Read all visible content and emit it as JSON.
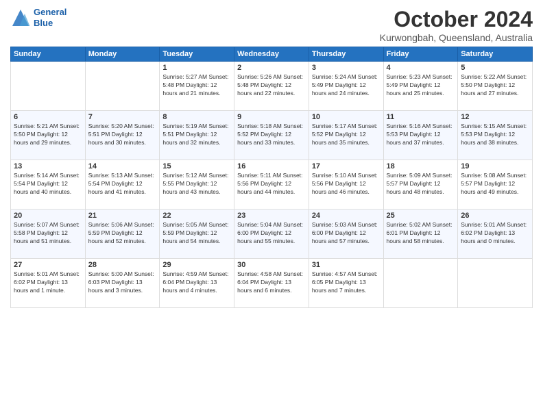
{
  "header": {
    "logo_line1": "General",
    "logo_line2": "Blue",
    "month": "October 2024",
    "location": "Kurwongbah, Queensland, Australia"
  },
  "days_of_week": [
    "Sunday",
    "Monday",
    "Tuesday",
    "Wednesday",
    "Thursday",
    "Friday",
    "Saturday"
  ],
  "weeks": [
    [
      {
        "day": "",
        "info": ""
      },
      {
        "day": "",
        "info": ""
      },
      {
        "day": "1",
        "info": "Sunrise: 5:27 AM\nSunset: 5:48 PM\nDaylight: 12 hours\nand 21 minutes."
      },
      {
        "day": "2",
        "info": "Sunrise: 5:26 AM\nSunset: 5:48 PM\nDaylight: 12 hours\nand 22 minutes."
      },
      {
        "day": "3",
        "info": "Sunrise: 5:24 AM\nSunset: 5:49 PM\nDaylight: 12 hours\nand 24 minutes."
      },
      {
        "day": "4",
        "info": "Sunrise: 5:23 AM\nSunset: 5:49 PM\nDaylight: 12 hours\nand 25 minutes."
      },
      {
        "day": "5",
        "info": "Sunrise: 5:22 AM\nSunset: 5:50 PM\nDaylight: 12 hours\nand 27 minutes."
      }
    ],
    [
      {
        "day": "6",
        "info": "Sunrise: 5:21 AM\nSunset: 5:50 PM\nDaylight: 12 hours\nand 29 minutes."
      },
      {
        "day": "7",
        "info": "Sunrise: 5:20 AM\nSunset: 5:51 PM\nDaylight: 12 hours\nand 30 minutes."
      },
      {
        "day": "8",
        "info": "Sunrise: 5:19 AM\nSunset: 5:51 PM\nDaylight: 12 hours\nand 32 minutes."
      },
      {
        "day": "9",
        "info": "Sunrise: 5:18 AM\nSunset: 5:52 PM\nDaylight: 12 hours\nand 33 minutes."
      },
      {
        "day": "10",
        "info": "Sunrise: 5:17 AM\nSunset: 5:52 PM\nDaylight: 12 hours\nand 35 minutes."
      },
      {
        "day": "11",
        "info": "Sunrise: 5:16 AM\nSunset: 5:53 PM\nDaylight: 12 hours\nand 37 minutes."
      },
      {
        "day": "12",
        "info": "Sunrise: 5:15 AM\nSunset: 5:53 PM\nDaylight: 12 hours\nand 38 minutes."
      }
    ],
    [
      {
        "day": "13",
        "info": "Sunrise: 5:14 AM\nSunset: 5:54 PM\nDaylight: 12 hours\nand 40 minutes."
      },
      {
        "day": "14",
        "info": "Sunrise: 5:13 AM\nSunset: 5:54 PM\nDaylight: 12 hours\nand 41 minutes."
      },
      {
        "day": "15",
        "info": "Sunrise: 5:12 AM\nSunset: 5:55 PM\nDaylight: 12 hours\nand 43 minutes."
      },
      {
        "day": "16",
        "info": "Sunrise: 5:11 AM\nSunset: 5:56 PM\nDaylight: 12 hours\nand 44 minutes."
      },
      {
        "day": "17",
        "info": "Sunrise: 5:10 AM\nSunset: 5:56 PM\nDaylight: 12 hours\nand 46 minutes."
      },
      {
        "day": "18",
        "info": "Sunrise: 5:09 AM\nSunset: 5:57 PM\nDaylight: 12 hours\nand 48 minutes."
      },
      {
        "day": "19",
        "info": "Sunrise: 5:08 AM\nSunset: 5:57 PM\nDaylight: 12 hours\nand 49 minutes."
      }
    ],
    [
      {
        "day": "20",
        "info": "Sunrise: 5:07 AM\nSunset: 5:58 PM\nDaylight: 12 hours\nand 51 minutes."
      },
      {
        "day": "21",
        "info": "Sunrise: 5:06 AM\nSunset: 5:59 PM\nDaylight: 12 hours\nand 52 minutes."
      },
      {
        "day": "22",
        "info": "Sunrise: 5:05 AM\nSunset: 5:59 PM\nDaylight: 12 hours\nand 54 minutes."
      },
      {
        "day": "23",
        "info": "Sunrise: 5:04 AM\nSunset: 6:00 PM\nDaylight: 12 hours\nand 55 minutes."
      },
      {
        "day": "24",
        "info": "Sunrise: 5:03 AM\nSunset: 6:00 PM\nDaylight: 12 hours\nand 57 minutes."
      },
      {
        "day": "25",
        "info": "Sunrise: 5:02 AM\nSunset: 6:01 PM\nDaylight: 12 hours\nand 58 minutes."
      },
      {
        "day": "26",
        "info": "Sunrise: 5:01 AM\nSunset: 6:02 PM\nDaylight: 13 hours\nand 0 minutes."
      }
    ],
    [
      {
        "day": "27",
        "info": "Sunrise: 5:01 AM\nSunset: 6:02 PM\nDaylight: 13 hours\nand 1 minute."
      },
      {
        "day": "28",
        "info": "Sunrise: 5:00 AM\nSunset: 6:03 PM\nDaylight: 13 hours\nand 3 minutes."
      },
      {
        "day": "29",
        "info": "Sunrise: 4:59 AM\nSunset: 6:04 PM\nDaylight: 13 hours\nand 4 minutes."
      },
      {
        "day": "30",
        "info": "Sunrise: 4:58 AM\nSunset: 6:04 PM\nDaylight: 13 hours\nand 6 minutes."
      },
      {
        "day": "31",
        "info": "Sunrise: 4:57 AM\nSunset: 6:05 PM\nDaylight: 13 hours\nand 7 minutes."
      },
      {
        "day": "",
        "info": ""
      },
      {
        "day": "",
        "info": ""
      }
    ]
  ]
}
